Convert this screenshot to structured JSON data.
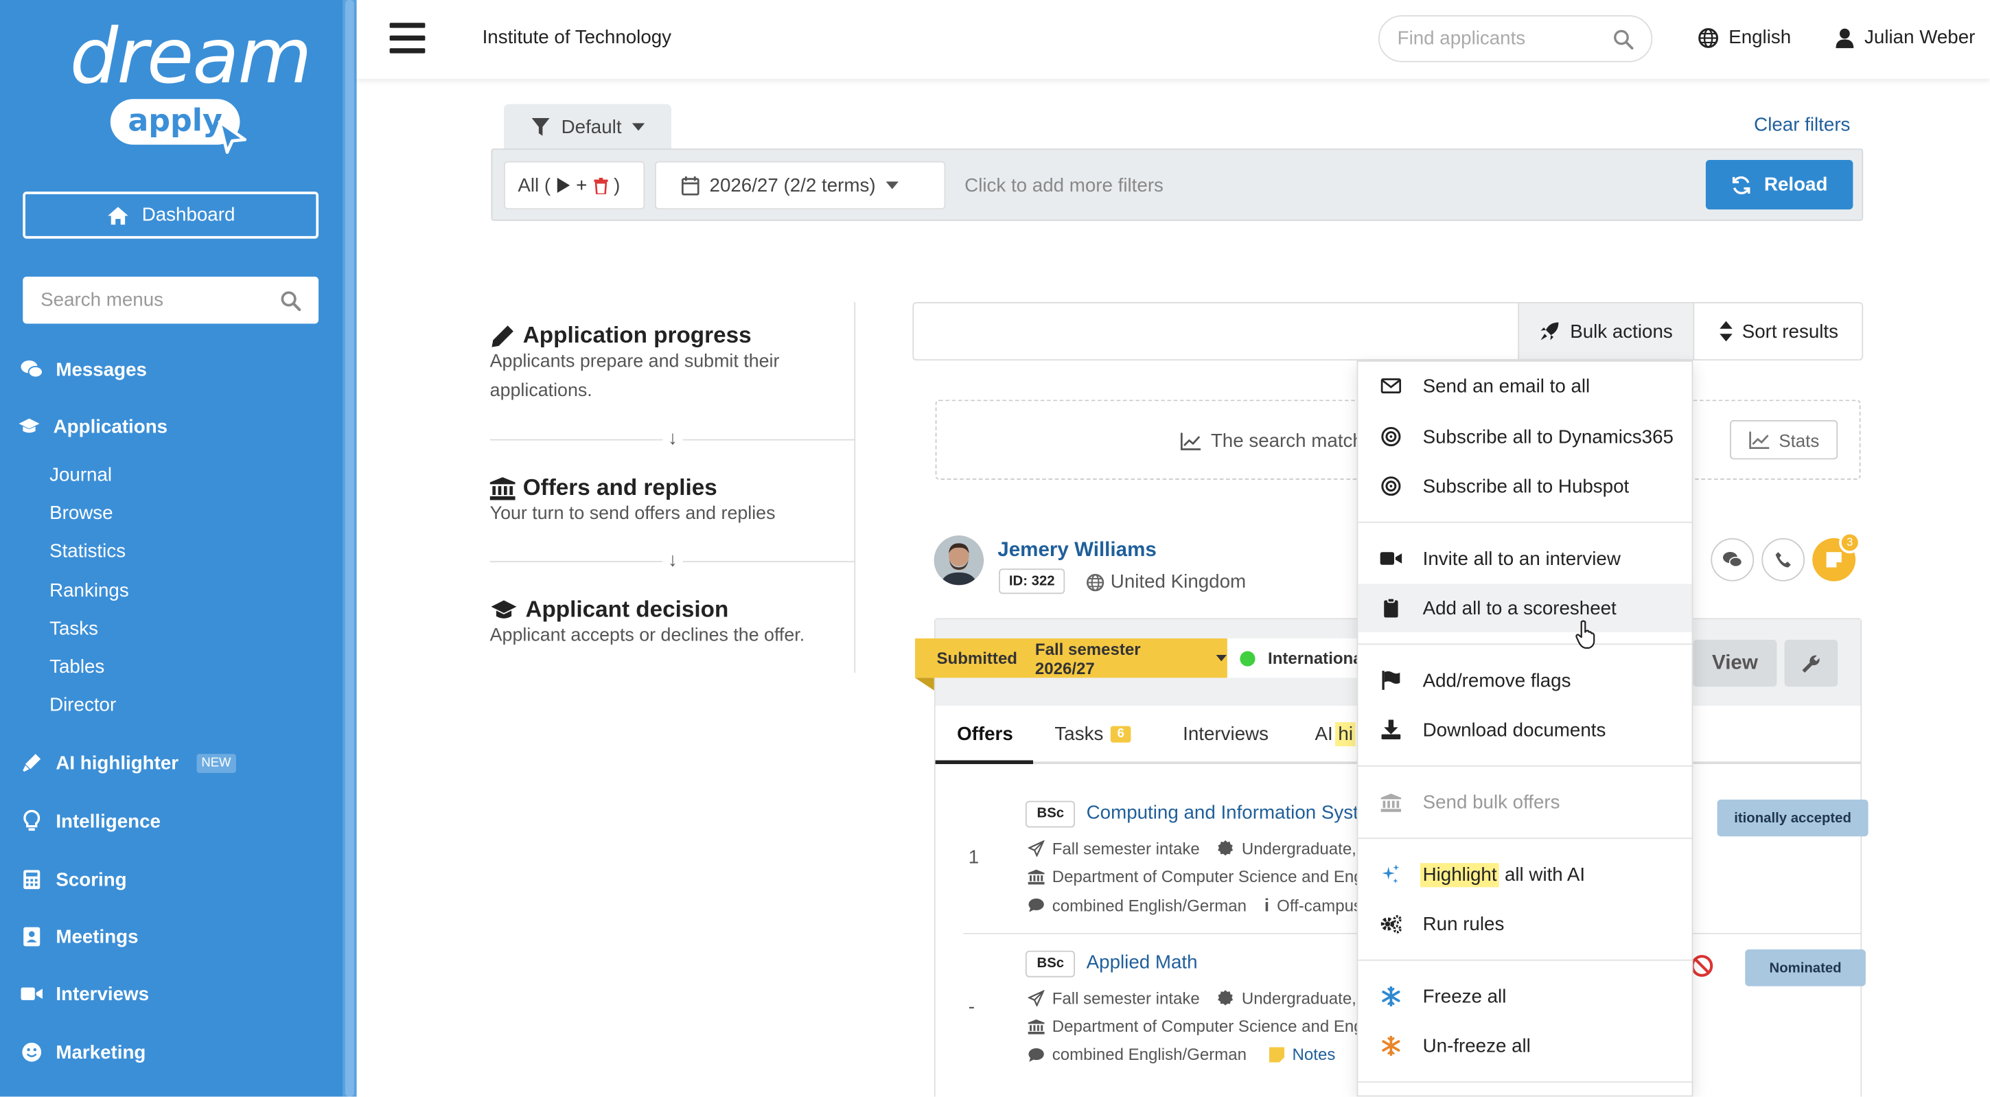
{
  "brand": {
    "word": "dream",
    "pill": "apply"
  },
  "sidebar": {
    "dashboard_label": "Dashboard",
    "search_placeholder": "Search menus",
    "messages": "Messages",
    "applications": "Applications",
    "sub_items": [
      "Journal",
      "Browse",
      "Statistics",
      "Rankings",
      "Tasks",
      "Tables",
      "Director"
    ],
    "ai_highlighter": "AI highlighter",
    "ai_new_badge": "NEW",
    "intelligence": "Intelligence",
    "scoring": "Scoring",
    "meetings": "Meetings",
    "interviews": "Interviews",
    "marketing": "Marketing"
  },
  "topbar": {
    "institution": "Institute of Technology",
    "find_placeholder": "Find applicants",
    "language": "English",
    "user_name": "Julian Weber"
  },
  "filters": {
    "preset": "Default",
    "clear_label": "Clear filters",
    "all_label": "All (",
    "all_close": ")",
    "term": "2026/27 (2/2 terms)",
    "more_placeholder": "Click to add more filters",
    "reload_label": "Reload"
  },
  "steps": [
    {
      "title": "Application progress",
      "desc": "Applicants prepare and submit their applications."
    },
    {
      "title": "Offers and replies",
      "desc": "Your turn to send offers and replies"
    },
    {
      "title": "Applicant decision",
      "desc": "Applicant accepts or declines the offer."
    }
  ],
  "results": {
    "bulk_label": "Bulk actions",
    "sort_label": "Sort results",
    "match_text": "The search match",
    "stats_label": "Stats"
  },
  "applicant": {
    "name": "Jemery Williams",
    "id": "ID: 322",
    "country": "United Kingdom",
    "notes_count": "3",
    "status": "Submitted",
    "intake": "Fall semester 2026/27",
    "tag": "Internationa",
    "view_label": "View",
    "tabs": {
      "offers": "Offers",
      "tasks": "Tasks",
      "tasks_count": "6",
      "interviews": "Interviews",
      "ai": "AI",
      "ai_hl": "hi"
    },
    "offers": [
      {
        "num": "1",
        "degree": "BSc",
        "program": "Computing and Information Syst",
        "intake": "Fall semester intake",
        "level": "Undergraduate, f",
        "department": "Department of Computer Science and Eng",
        "language": "combined English/German",
        "extra": "Off-campus",
        "status": "itionally accepted"
      },
      {
        "num": "-",
        "degree": "BSc",
        "program": "Applied Math",
        "intake": "Fall semester intake",
        "level": "Undergraduate, f",
        "department": "Department of Computer Science and Eng",
        "language": "combined English/German",
        "extra": "Notes",
        "status": "Nominated"
      }
    ]
  },
  "bulk_menu": {
    "email_all": "Send an email to all",
    "dynamics": "Subscribe all to Dynamics365",
    "hubspot": "Subscribe all to Hubspot",
    "interview": "Invite all to an interview",
    "scoresheet": "Add all to a scoresheet",
    "flags": "Add/remove flags",
    "download": "Download documents",
    "offers": "Send bulk offers",
    "highlight_word": "Highlight",
    "highlight_rest": "all with AI",
    "rules": "Run rules",
    "freeze": "Freeze all",
    "unfreeze": "Un-freeze all"
  },
  "colors": {
    "sidebar": "#3b8fd7",
    "primary": "#2f89d1",
    "link": "#1f5f9a",
    "status": "#f5c842",
    "offer_badge": "#a9c7df"
  }
}
